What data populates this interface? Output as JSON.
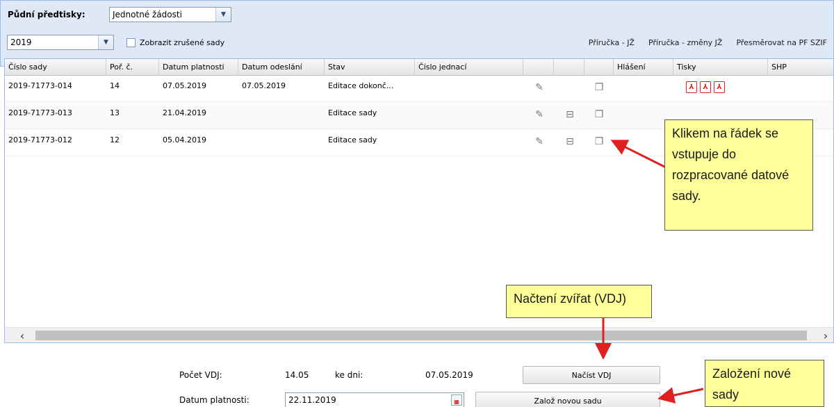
{
  "filter": {
    "forms_label": "Půdní předtisky:",
    "forms_value": "Jednotné žádosti",
    "year_value": "2019",
    "show_cancelled_label": "Zobrazit zrušené sady",
    "links": [
      "Příručka - JŽ",
      "Příručka - změny JŽ",
      "Přesměrovat na PF SZIF"
    ]
  },
  "grid": {
    "columns": [
      "Číslo sady",
      "Poř. č.",
      "Datum platnosti",
      "Datum odeslání",
      "Stav",
      "Číslo jednací",
      "",
      "",
      "",
      "Hlášení",
      "Tisky",
      "SHP"
    ],
    "rows": [
      {
        "cislo": "2019-71773-014",
        "por": "14",
        "platnost": "07.05.2019",
        "odeslani": "07.05.2019",
        "stav": "Editace dokonč...",
        "jednaci": "",
        "edit_icon": "edit-icon",
        "minus_icon": "",
        "copy_icon": "copy-icon",
        "pdf_count": 3
      },
      {
        "cislo": "2019-71773-013",
        "por": "13",
        "platnost": "21.04.2019",
        "odeslani": "",
        "stav": "Editace sady",
        "jednaci": "",
        "edit_icon": "edit-icon",
        "minus_icon": "minus-box-icon",
        "copy_icon": "copy-icon",
        "pdf_count": 0
      },
      {
        "cislo": "2019-71773-012",
        "por": "12",
        "platnost": "05.04.2019",
        "odeslani": "",
        "stav": "Editace sady",
        "jednaci": "",
        "edit_icon": "edit-icon",
        "minus_icon": "minus-box-icon",
        "copy_icon": "copy-icon",
        "pdf_count": 0
      }
    ]
  },
  "bottom": {
    "pocet_label": "Počet VDJ:",
    "pocet_value": "14.05",
    "ke_dni_label": "ke dni:",
    "ke_dni_value": "07.05.2019",
    "load_button": "Načíst VDJ",
    "platnost_label": "Datum platnosti:",
    "platnost_value": "22.11.2019",
    "new_button": "Založ novou sadu"
  },
  "callouts": {
    "row_click": "Klikem na řádek se vstupuje do rozpracované datové sady.",
    "load_animals": "Načtení zvířat (VDJ)",
    "new_set": "Založení nové sady"
  },
  "colors": {
    "header_bg": "#dfe8f6",
    "callout_bg": "#ffff99",
    "arrow": "#e02020",
    "pdf": "#e02020"
  }
}
